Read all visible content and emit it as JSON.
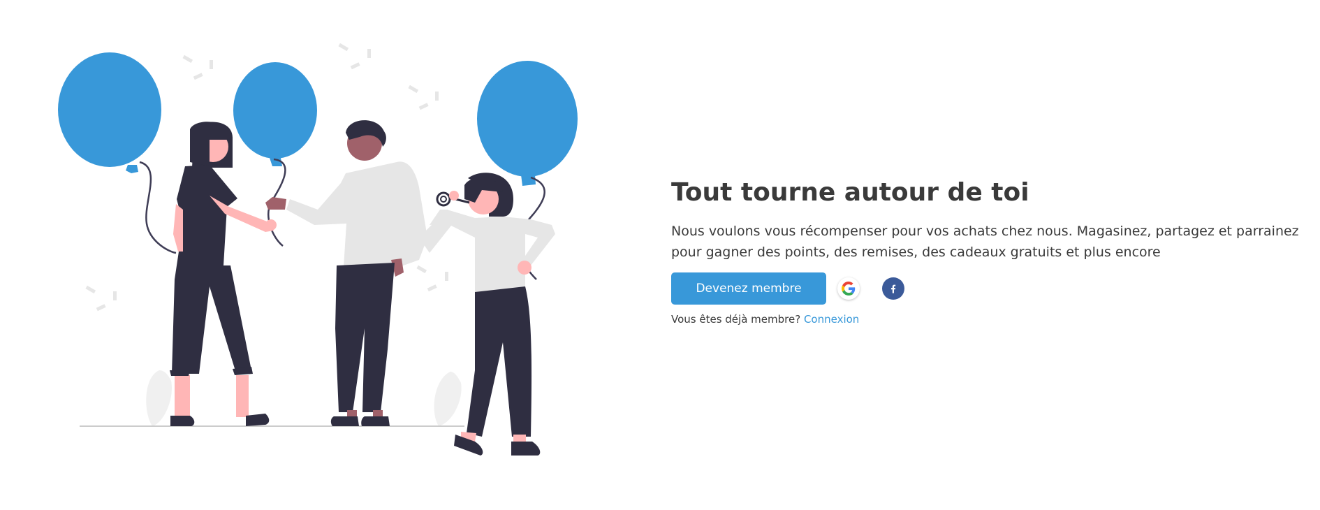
{
  "hero": {
    "title": "Tout tourne autour de toi",
    "description_line1": "Nous voulons vous récompenser pour vos achats chez nous. Magasinez, partagez et parrainez",
    "description_line2": "pour gagner des points, des remises, des cadeaux gratuits et plus encore",
    "join_button_label": "Devenez membre",
    "social_icons": [
      "google-icon",
      "facebook-icon"
    ],
    "already_member_text": "Vous êtes déjà membre?",
    "login_link_label": "Connexion"
  },
  "colors": {
    "accent": "#3898d9",
    "facebook": "#3b5a99",
    "title_text": "#3a3a3a",
    "figure_dark": "#2f2e41",
    "figure_light": "#e6e6e6",
    "skin_light": "#ffb6b6",
    "skin_dark": "#a0616a"
  }
}
